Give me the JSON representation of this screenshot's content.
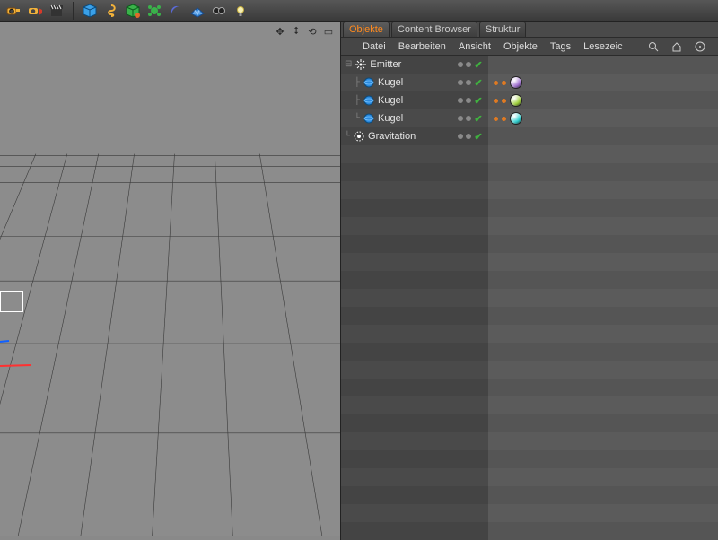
{
  "toolbar": {
    "icons": [
      "camera",
      "render",
      "clapper",
      "cube",
      "spiral",
      "cube-physics",
      "array",
      "bend",
      "floor",
      "goggles",
      "light"
    ]
  },
  "viewport": {
    "corner_icons": [
      "move",
      "zoom",
      "rotate",
      "maximize"
    ]
  },
  "panel": {
    "tabs": [
      {
        "label": "Objekte",
        "active": true
      },
      {
        "label": "Content Browser",
        "active": false
      },
      {
        "label": "Struktur",
        "active": false
      }
    ],
    "menu": [
      "Datei",
      "Bearbeiten",
      "Ansicht",
      "Objekte",
      "Tags",
      "Lesezeic"
    ],
    "menu_icons": [
      "search",
      "home",
      "feedback",
      "add"
    ],
    "tree": [
      {
        "name": "Emitter",
        "icon": "emitter",
        "depth": 0,
        "expand": "minus",
        "tags": []
      },
      {
        "name": "Kugel",
        "icon": "sphere",
        "depth": 1,
        "expand": "tee",
        "tags": {
          "mat": "#a070d0"
        }
      },
      {
        "name": "Kugel",
        "icon": "sphere",
        "depth": 1,
        "expand": "tee",
        "tags": {
          "mat": "#9ecf3a"
        }
      },
      {
        "name": "Kugel",
        "icon": "sphere",
        "depth": 1,
        "expand": "elbow",
        "tags": {
          "mat": "#30cfcf"
        }
      },
      {
        "name": "Gravitation",
        "icon": "gravitation",
        "depth": 0,
        "expand": "elbow",
        "tags": []
      }
    ]
  }
}
